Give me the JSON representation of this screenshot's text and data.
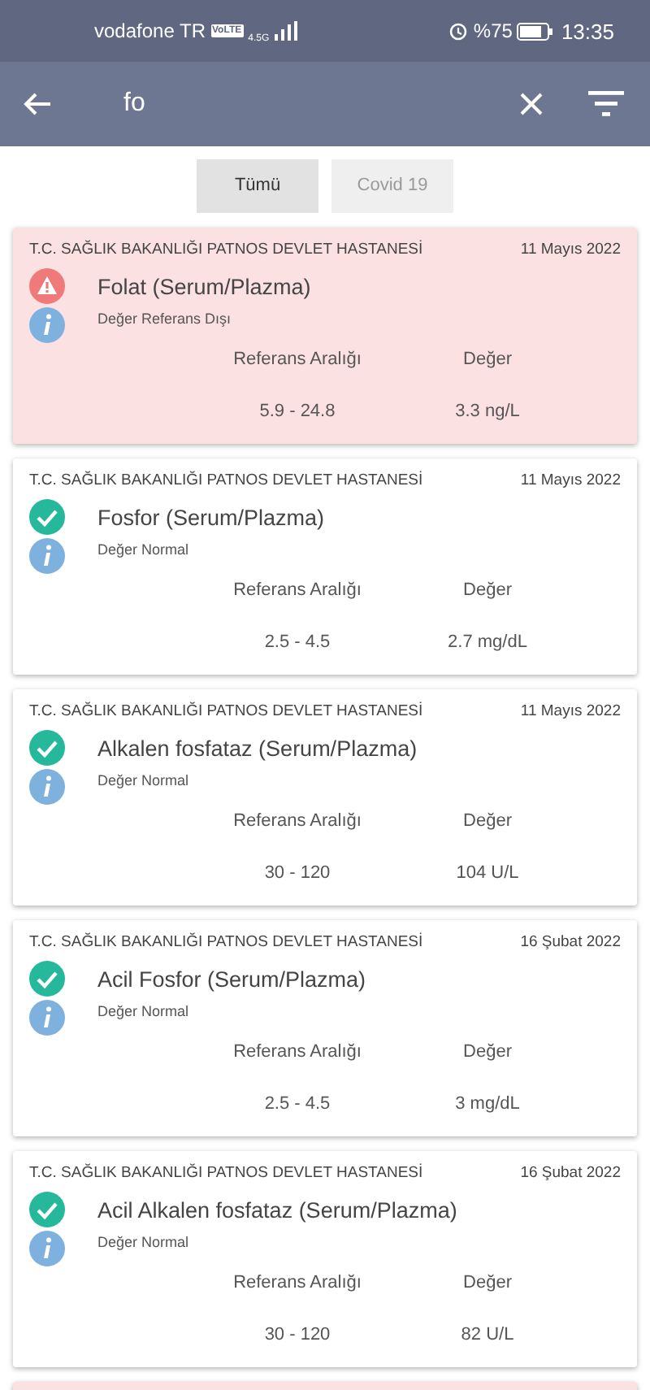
{
  "status_bar": {
    "carrier": "vodafone TR",
    "volte": "VoLTE",
    "network": "4.5G",
    "battery": "%75",
    "time": "13:35"
  },
  "search": {
    "value": "fo"
  },
  "filters": [
    {
      "label": "Tümü",
      "selected": true
    },
    {
      "label": "Covid 19",
      "selected": false
    }
  ],
  "results": [
    {
      "kind": "abnormal",
      "hospital": "T.C. SAĞLIK BAKANLIĞI PATNOS DEVLET HASTANESİ",
      "date": "11 Mayıs 2022",
      "test": "Folat (Serum/Plazma)",
      "note": "Değer Referans Dışı",
      "range_label": "Referans Aralığı",
      "value_label": "Değer",
      "range": "5.9 - 24.8",
      "value": "3.3 ng/L"
    },
    {
      "kind": "normal",
      "hospital": "T.C. SAĞLIK BAKANLIĞI PATNOS DEVLET HASTANESİ",
      "date": "11 Mayıs 2022",
      "test": "Fosfor (Serum/Plazma)",
      "note": "Değer Normal",
      "range_label": "Referans Aralığı",
      "value_label": "Değer",
      "range": "2.5 - 4.5",
      "value": "2.7 mg/dL"
    },
    {
      "kind": "normal",
      "hospital": "T.C. SAĞLIK BAKANLIĞI PATNOS DEVLET HASTANESİ",
      "date": "11 Mayıs 2022",
      "test": "Alkalen fosfataz (Serum/Plazma)",
      "note": "Değer Normal",
      "range_label": "Referans Aralığı",
      "value_label": "Değer",
      "range": "30 - 120",
      "value": "104 U/L"
    },
    {
      "kind": "normal",
      "hospital": "T.C. SAĞLIK BAKANLIĞI PATNOS DEVLET HASTANESİ",
      "date": "16 Şubat 2022",
      "test": "Acil Fosfor (Serum/Plazma)",
      "note": "Değer Normal",
      "range_label": "Referans Aralığı",
      "value_label": "Değer",
      "range": "2.5 - 4.5",
      "value": "3 mg/dL"
    },
    {
      "kind": "normal",
      "hospital": "T.C. SAĞLIK BAKANLIĞI PATNOS DEVLET HASTANESİ",
      "date": "16 Şubat 2022",
      "test": "Acil Alkalen fosfataz (Serum/Plazma)",
      "note": "Değer Normal",
      "range_label": "Referans Aralığı",
      "value_label": "Değer",
      "range": "30 - 120",
      "value": "82 U/L"
    },
    {
      "kind": "abnormal"
    }
  ]
}
